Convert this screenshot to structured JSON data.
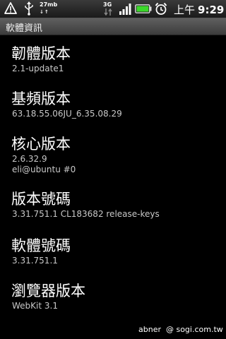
{
  "status_bar": {
    "data_usage": "27mb",
    "network_type": "3G",
    "clock_ampm": "上午",
    "clock_time": "9:29",
    "icons": [
      "warning-icon",
      "usb-icon",
      "signal-icon",
      "battery-icon",
      "alarm-icon"
    ]
  },
  "title_bar": {
    "title": "軟體資訊"
  },
  "items": [
    {
      "label": "韌體版本",
      "value": "2.1-update1"
    },
    {
      "label": "基頻版本",
      "value": "63.18.55.06JU_6.35.08.29"
    },
    {
      "label": "核心版本",
      "value": "2.6.32.9",
      "value2": "eli@ubuntu #0"
    },
    {
      "label": "版本號碼",
      "value": "3.31.751.1 CL183682 release-keys"
    },
    {
      "label": "軟體號碼",
      "value": "3.31.751.1"
    },
    {
      "label": "瀏覽器版本",
      "value": "WebKit 3.1"
    }
  ],
  "watermark": "abner  @ sogi.com.tw",
  "colors": {
    "background": "#000000",
    "battery_fill": "#3bd82a"
  }
}
